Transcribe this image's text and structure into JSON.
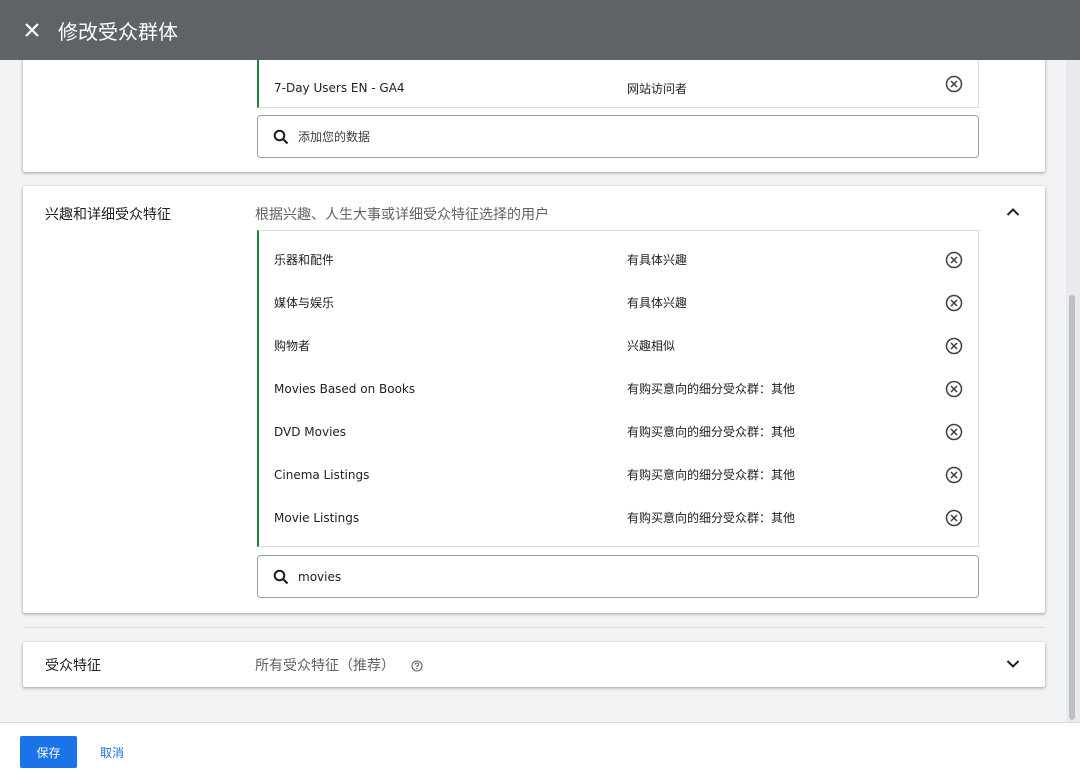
{
  "dialog": {
    "title": "修改受众群体",
    "close_icon": "close-icon"
  },
  "your_data": {
    "items": [
      {
        "name": "7-Day Users EN - GA4",
        "type": "网站访问者"
      }
    ],
    "search_placeholder": "添加您的数据"
  },
  "interests": {
    "label": "兴趣和详细受众特征",
    "description": "根据兴趣、人生大事或详细受众特征选择的用户",
    "items": [
      {
        "name": "乐器和配件",
        "type": "有具体兴趣"
      },
      {
        "name": "媒体与娱乐",
        "type": "有具体兴趣"
      },
      {
        "name": "购物者",
        "type": "兴趣相似"
      },
      {
        "name": "Movies Based on Books",
        "type": "有购买意向的细分受众群：其他"
      },
      {
        "name": "DVD Movies",
        "type": "有购买意向的细分受众群：其他"
      },
      {
        "name": "Cinema Listings",
        "type": "有购买意向的细分受众群：其他"
      },
      {
        "name": "Movie Listings",
        "type": "有购买意向的细分受众群：其他"
      }
    ],
    "search_value": "movies"
  },
  "demographics": {
    "label": "受众特征",
    "description": "所有受众特征（推荐）"
  },
  "footer": {
    "save_label": "保存",
    "cancel_label": "取消"
  },
  "colors": {
    "primary": "#1a73e8",
    "selection_accent": "#188038",
    "header_bg": "#5f6368"
  }
}
